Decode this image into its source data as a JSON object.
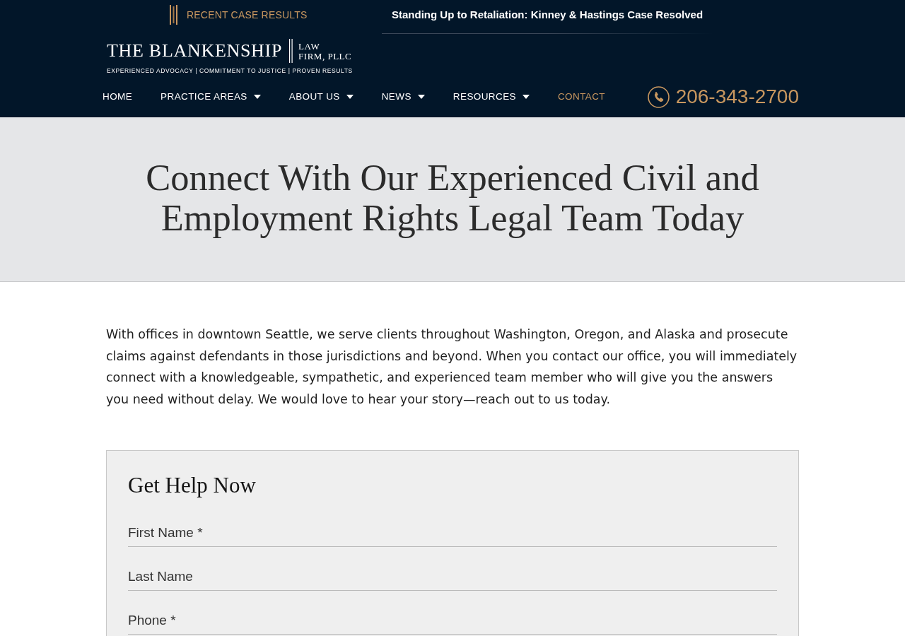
{
  "top_bar": {
    "label": "RECENT CASE RESULTS",
    "headline": "Standing Up to Retaliation: Kinney & Hastings Case Resolved"
  },
  "logo": {
    "name": "THE BLANKENSHIP",
    "suffix": [
      "LAW",
      "FIRM, PLLC"
    ],
    "tagline": "EXPERIENCED ADVOCACY | COMMITMENT TO JUSTICE | PROVEN RESULTS"
  },
  "nav": {
    "items": [
      {
        "label": "HOME",
        "has_dropdown": false,
        "selected": false
      },
      {
        "label": "PRACTICE AREAS",
        "has_dropdown": true,
        "selected": false
      },
      {
        "label": "ABOUT US",
        "has_dropdown": true,
        "selected": false
      },
      {
        "label": "NEWS",
        "has_dropdown": true,
        "selected": false
      },
      {
        "label": "RESOURCES",
        "has_dropdown": true,
        "selected": false
      },
      {
        "label": "CONTACT",
        "has_dropdown": false,
        "selected": true
      }
    ],
    "phone": "206-343-2700"
  },
  "hero": {
    "title": "Connect With Our Experienced Civil and Employment Rights Legal Team Today"
  },
  "intro": "With offices in downtown Seattle, we serve clients throughout Washington, Oregon, and Alaska and prosecute claims against defendants in those jurisdictions and beyond. When you contact our office, you will immediately connect with a knowledgeable, sympathetic, and experienced team member who will give you the answers you need without delay. We would love to hear your story—reach out to us today.",
  "form": {
    "title": "Get Help Now",
    "fields": [
      {
        "placeholder": "First Name *"
      },
      {
        "placeholder": "Last Name"
      },
      {
        "placeholder": "Phone *"
      }
    ]
  }
}
